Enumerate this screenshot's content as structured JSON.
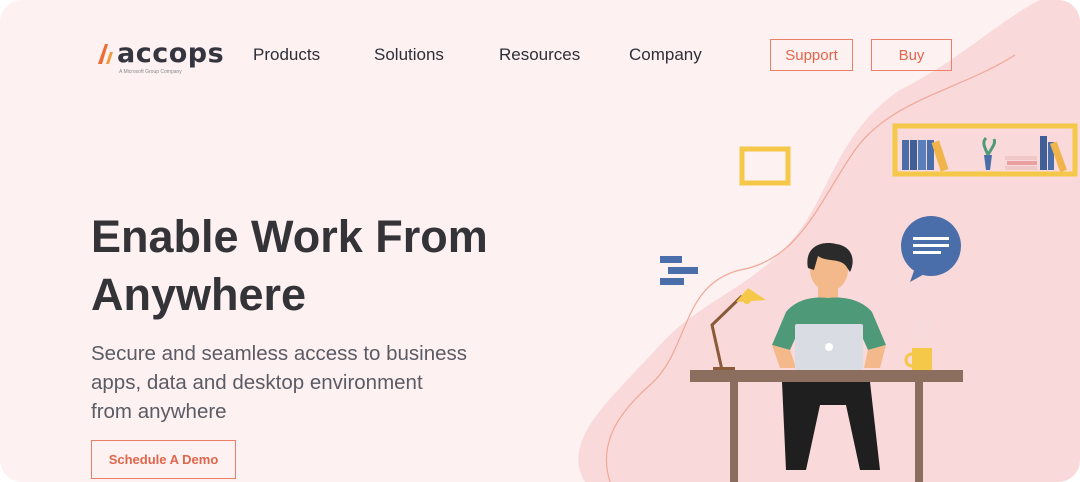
{
  "brand": {
    "name": "accops",
    "tagline": "A Microsoft Group Company"
  },
  "nav": {
    "links": [
      "Products",
      "Solutions",
      "Resources",
      "Company"
    ],
    "support_label": "Support",
    "buy_label": "Buy"
  },
  "hero": {
    "title_line1": "Enable Work From",
    "title_line2": "Anywhere",
    "subtitle_line1": "Secure and seamless access to business",
    "subtitle_line2": "apps, data and desktop environment",
    "subtitle_line3": "from anywhere",
    "cta_label": "Schedule A Demo"
  },
  "colors": {
    "accent": "#ec8067",
    "background": "#fdf1f2",
    "blob": "#f9d9d9",
    "text_dark": "#333338"
  },
  "icons": [
    "accops-logo-icon",
    "chat-bubble-icon",
    "laptop-icon",
    "desk-lamp-icon",
    "coffee-mug-icon",
    "bookshelf-icon",
    "picture-frame-icon",
    "gantt-bars-icon"
  ]
}
